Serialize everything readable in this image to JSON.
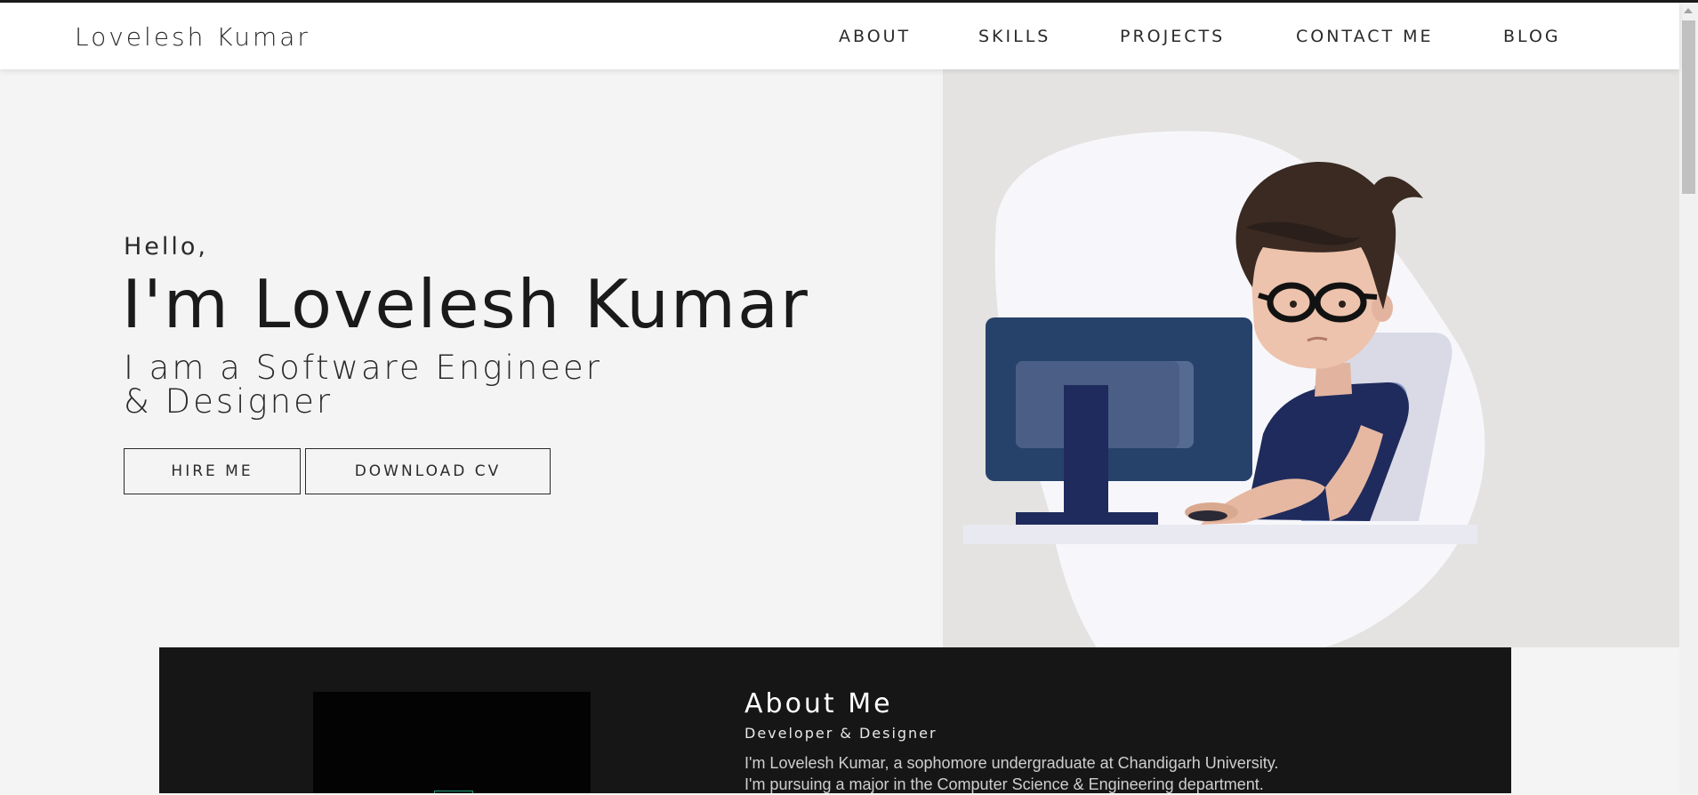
{
  "brand": "Lovelesh Kumar",
  "nav": {
    "items": [
      {
        "label": "ABOUT"
      },
      {
        "label": "SKILLS"
      },
      {
        "label": "PROJECTS"
      },
      {
        "label": "CONTACT ME"
      },
      {
        "label": "BLOG"
      }
    ]
  },
  "hero": {
    "greeting": "Hello,",
    "name": "I'm Lovelesh Kumar",
    "tagline_line1": "I am a Software Engineer",
    "tagline_line2": "& Designer",
    "hire_label": "HIRE ME",
    "cv_label": "DOWNLOAD CV"
  },
  "about": {
    "title": "About Me",
    "subtitle": "Developer & Designer",
    "line1": "I'm Lovelesh Kumar, a sophomore undergraduate at Chandigarh University.",
    "line2": "I'm pursuing a major in the Computer Science & Engineering department."
  },
  "colors": {
    "page_bg": "#f4f4f4",
    "illustration_bg": "#e4e3e1",
    "about_bg": "#161616",
    "monitor": "#27426a",
    "shirt": "#1f2b5c"
  },
  "icons": {
    "hero_illustration": "developer-at-computer-illustration"
  }
}
